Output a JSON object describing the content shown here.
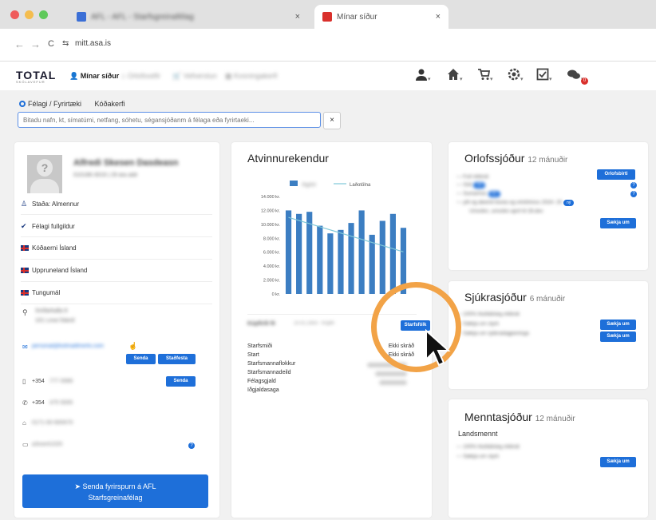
{
  "browser": {
    "tabs": [
      {
        "title": "AFL - AFL - Starfsgreinafélag",
        "close": "×",
        "color": "#3b6fd6"
      },
      {
        "title": "Mínar síður",
        "close": "×",
        "color": "#d9302c"
      }
    ],
    "url": "mitt.asa.is",
    "back": "←",
    "forward": "→",
    "reload": "C",
    "site_info": "⇆"
  },
  "navbar": {
    "logo": "TOTAL",
    "logo_sub": "SKÓLAVEFUR",
    "links": [
      {
        "label": "Mínar síður",
        "icon": "👤"
      },
      {
        "label": "Orlofsvefir",
        "icon": "⌂"
      },
      {
        "label": "Vefverslun",
        "icon": "🛒"
      },
      {
        "label": "Kosningakerfi",
        "icon": "▦"
      }
    ],
    "icons": [
      "user",
      "home",
      "cart",
      "gear",
      "check",
      "chat"
    ],
    "caret": "▾",
    "badge": "0"
  },
  "search": {
    "option_1": "Félagi / Fyrirtæki",
    "option_2": "Kóðakerfi",
    "placeholder": "Bitadu nafn, kt, símatúmi, netfang, sóhetu, sé⁠gansjóðanm á félaga eða fyrirtaeki...",
    "clear": "×"
  },
  "profile": {
    "name": "Alfredi Skesen Dasdeasn",
    "meta": "010186-3019 | 29 ára aldr",
    "rows": [
      {
        "icon": "♙",
        "label": "Staða: Almennur"
      },
      {
        "icon": "✔",
        "label": "Félagi fullgildur"
      },
      {
        "flag": true,
        "label": "Kóðaerni Ísland"
      },
      {
        "flag": true,
        "label": "Uppruneland Ísland"
      },
      {
        "flag": true,
        "label": "Tungumál"
      }
    ],
    "address_1": "Sniðarkalla 8",
    "address_2": "101 Lova Ísland",
    "email": "personal@kotmaillmerki.com",
    "btn_send": "Senda",
    "btn_confirm": "Staðfesta",
    "phone_1": "+354",
    "phone_1_val": "777 0089",
    "btn_sms": "Senda",
    "phone_2": "+354",
    "phone_2_val": "475 5005",
    "kennitala": "0171-00-900670",
    "bank": "a3xxe41020",
    "help": "?",
    "send_button": "Senda fyrirspurn á AFL\nStarfsgreinafélag"
  },
  "chart_card": {
    "title": "Atvinnurekendur",
    "legend_bar": "Iðgjöld",
    "legend_line": "Laðotölna",
    "employer": "Kúpfirði fé",
    "employer_meta": "10.01.1950 - Kúpfir",
    "starfsfolk_btn": "Starfsfólk",
    "fields": [
      {
        "label": "Starfsmiði",
        "value": "Ekki skráð"
      },
      {
        "label": "Start",
        "value": "Ekki skráð"
      },
      {
        "label": "Starfsmannaflokkur",
        "value": ""
      },
      {
        "label": "Starfsmannadeild",
        "value": ""
      },
      {
        "label": "Félagsgjald",
        "value": ""
      },
      {
        "label": "Iðgjaldasaga",
        "value": ""
      }
    ]
  },
  "chart_data": {
    "type": "bar",
    "categories": [
      "",
      "",
      "",
      "",
      "",
      "",
      "",
      "",
      "",
      "",
      "",
      ""
    ],
    "series": [
      {
        "name": "Iðgjöld",
        "type": "bar",
        "values": [
          12000,
          11500,
          11800,
          9800,
          8700,
          9200,
          10200,
          12000,
          8500,
          10500,
          11500,
          9500
        ]
      },
      {
        "name": "Laðotölna",
        "type": "line",
        "values": [
          11000,
          10550,
          10100,
          9650,
          9200,
          8750,
          8300,
          7850,
          7400,
          6950,
          6500,
          6050
        ]
      }
    ],
    "yticks": [
      "0 kr.",
      "2.000 kr.",
      "4.000 kr.",
      "6.000 kr.",
      "8.000 kr.",
      "10.000 kr.",
      "12.000 kr.",
      "14.000 kr."
    ],
    "ylim": [
      0,
      14000
    ],
    "title": "",
    "xlabel": "",
    "ylabel": "",
    "bar_color": "#3c7ec2",
    "line_color": "#7fc8d8"
  },
  "orlof": {
    "title": "Orlofssjóður",
    "sub": "12 mánuðir",
    "rows": [
      {
        "label": "— Full réttindi",
        "pill": ""
      },
      {
        "label": "— Sóti",
        "pill": "0/0"
      },
      {
        "label": "— Sumarhús",
        "pill": "0/1"
      },
      {
        "label": "— yði og ákemit bústa og orlofshúss 2024- 25",
        "pill": "ný"
      }
    ],
    "note": "Umsókn, umsókn apríl til 28.des",
    "btn_top": "Orlofsbirti",
    "btn_bottom": "Sækja um",
    "q": "?"
  },
  "sjukra": {
    "title": "Sjúkrasjóður",
    "sub": "6 mánuðir",
    "rows": [
      "— 100% hlutfallsleg réttindi",
      "— Sækja um styrk",
      "— Sækja um sjúkradagpeninga"
    ],
    "btn": "Sækja um"
  },
  "mennt": {
    "title": "Menntasjóður",
    "sub": "12 mánuðir",
    "subtitle": "Landsmennt",
    "rows": [
      "— 100% hlutfallsleg réttindi",
      "— Sækja um styrk"
    ],
    "btn": "Sækja um"
  }
}
